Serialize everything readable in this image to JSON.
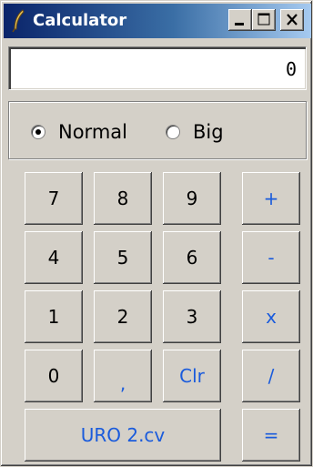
{
  "window": {
    "title": "Calculator",
    "controls": {
      "minimize": "_",
      "maximize": "□",
      "close": "X"
    }
  },
  "display": {
    "value": "0"
  },
  "mode": {
    "options": [
      {
        "label": "Normal",
        "checked": true
      },
      {
        "label": "Big",
        "checked": false
      }
    ]
  },
  "keys": {
    "k7": "7",
    "k8": "8",
    "k9": "9",
    "plus": "+",
    "k4": "4",
    "k5": "5",
    "k6": "6",
    "minus": "-",
    "k1": "1",
    "k2": "2",
    "k3": "3",
    "times": "x",
    "k0": "0",
    "period": ",",
    "clear": "Clr",
    "divide": "/",
    "credit": "URO 2.cv",
    "equals": "="
  },
  "colors": {
    "accent_text": "#1a5bdc",
    "face": "#d4d0c8",
    "title_start": "#0a246a",
    "title_end": "#a6caf0"
  }
}
